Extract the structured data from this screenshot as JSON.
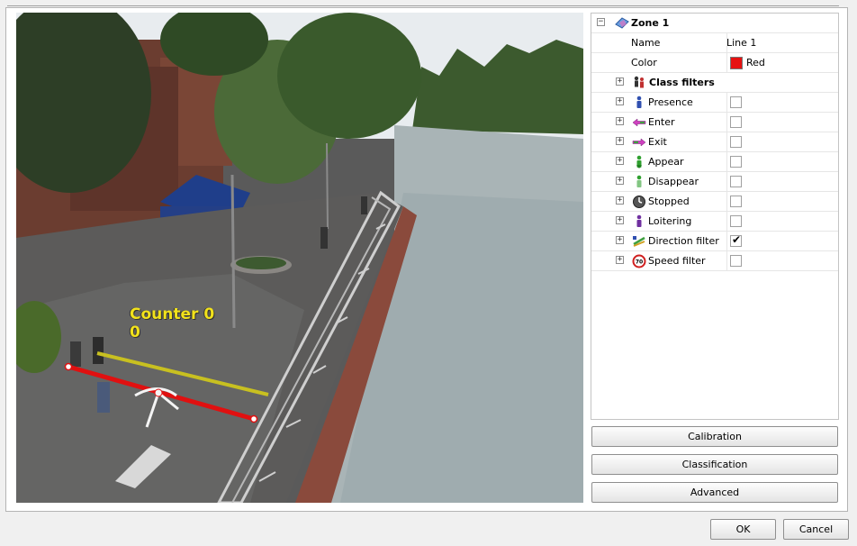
{
  "video": {
    "counter_label": "Counter 0",
    "counter_value": "0"
  },
  "tree": {
    "zone": {
      "label": "Zone 1",
      "icon": "zone-icon"
    },
    "name": {
      "label": "Name",
      "value": "Line 1"
    },
    "color": {
      "label": "Color",
      "value": "Red",
      "swatch": "#e61212"
    },
    "class_filters": {
      "label": "Class filters",
      "icon": "class-filters-icon"
    },
    "filters": [
      {
        "label": "Presence",
        "icon": "presence-icon",
        "checked": false
      },
      {
        "label": "Enter",
        "icon": "enter-icon",
        "checked": false
      },
      {
        "label": "Exit",
        "icon": "exit-icon",
        "checked": false
      },
      {
        "label": "Appear",
        "icon": "appear-icon",
        "checked": false
      },
      {
        "label": "Disappear",
        "icon": "disappear-icon",
        "checked": false
      },
      {
        "label": "Stopped",
        "icon": "stopped-icon",
        "checked": false
      },
      {
        "label": "Loitering",
        "icon": "loitering-icon",
        "checked": false
      },
      {
        "label": "Direction filter",
        "icon": "direction-filter-icon",
        "checked": true
      },
      {
        "label": "Speed filter",
        "icon": "speed-filter-icon",
        "checked": false
      }
    ],
    "checkmark": "✔"
  },
  "buttons": {
    "calibration": "Calibration",
    "classification": "Classification",
    "advanced": "Advanced",
    "ok": "OK",
    "cancel": "Cancel"
  },
  "colors": {
    "line_red": "#e01010",
    "direction_line": "#c8c020",
    "counter_text": "#f2e21b"
  }
}
